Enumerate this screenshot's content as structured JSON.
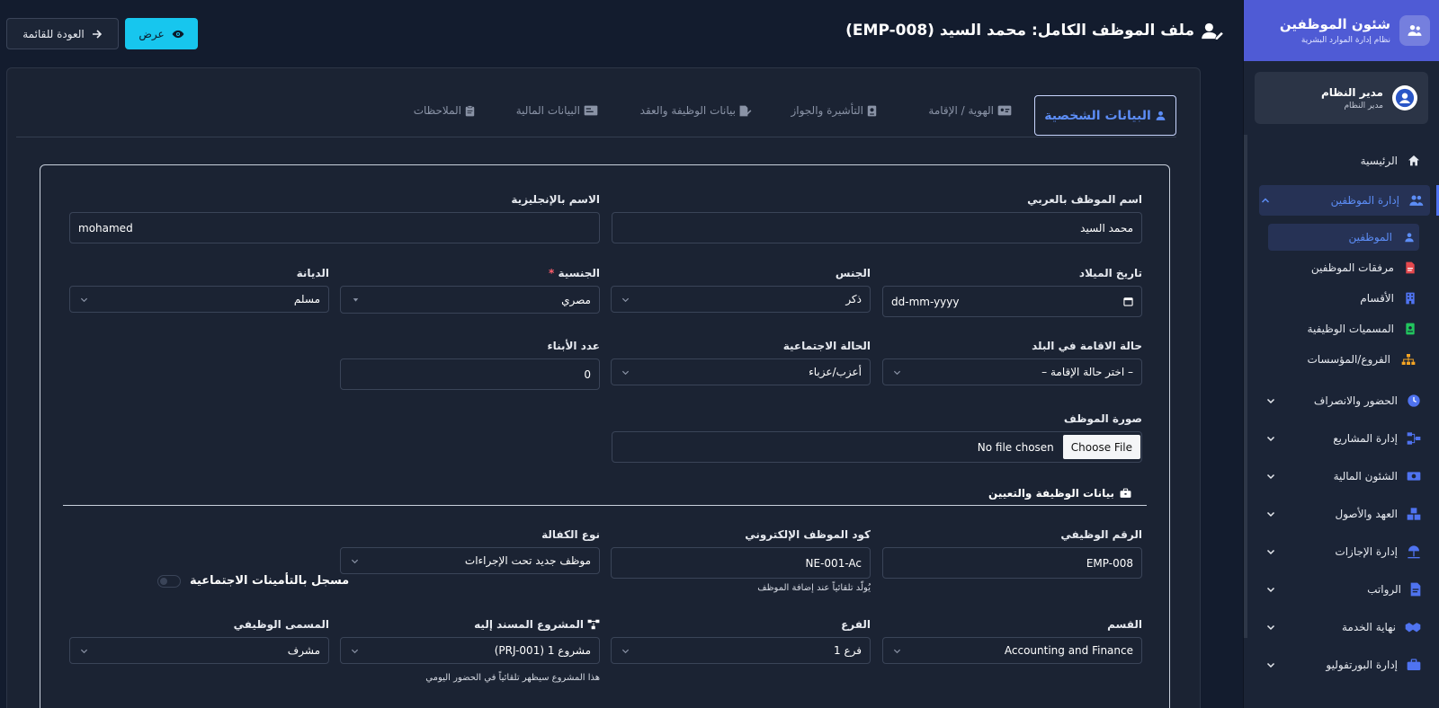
{
  "app": {
    "name": "شئون الموظفين",
    "subtitle": "نظام إدارة الموارد البشرية"
  },
  "user": {
    "name": "مدير النظام",
    "role": "مدير النظام"
  },
  "nav": {
    "home": "الرئيسية",
    "employees_mgmt": "إدارة الموظفين",
    "sub": {
      "employees": "الموظفين",
      "attachments": "مرفقات الموظفين",
      "departments": "الأقسام",
      "job_titles": "المسميات الوظيفية",
      "branches": "الفروع/المؤسسات"
    },
    "attendance": "الحضور والانصراف",
    "projects": "إدارة المشاريع",
    "finance": "الشئون المالية",
    "assets": "العهد والأصول",
    "leaves": "إدارة الإجازات",
    "salaries": "الرواتب",
    "end_of_service": "نهاية الخدمة",
    "portfolio": "إدارة البورتفوليو"
  },
  "header": {
    "title": "ملف الموظف الكامل: محمد السيد (EMP-008)",
    "view_btn": "عرض",
    "back_btn": "العودة للقائمة"
  },
  "tabs": {
    "personal": "البيانات الشخصية",
    "identity": "الهوية / الإقامة",
    "visa": "التأشيرة والجواز",
    "job": "بيانات الوظيفة والعقد",
    "financial": "البيانات المالية",
    "notes": "الملاحظات"
  },
  "form": {
    "name_ar": {
      "label": "اسم الموظف بالعربي",
      "value": "محمد السيد"
    },
    "name_en": {
      "label": "الاسم بالإنجليزية",
      "value": "mohamed"
    },
    "birth_date": {
      "label": "تاريخ الميلاد",
      "value": "dd-mm-yyyy"
    },
    "gender": {
      "label": "الجنس",
      "value": "ذكر"
    },
    "nationality": {
      "label": "الجنسية",
      "required": "*",
      "value": "مصري"
    },
    "religion": {
      "label": "الديانة",
      "value": "مسلم"
    },
    "residency": {
      "label": "حالة الاقامة في البلد",
      "value": "– اختر حالة الإقامة –"
    },
    "marital": {
      "label": "الحالة الاجتماعية",
      "value": "أعزب/عزباء"
    },
    "children": {
      "label": "عدد الأبناء",
      "value": "0"
    },
    "photo": {
      "label": "صورة الموظف",
      "button": "Choose File",
      "status": "No file chosen"
    }
  },
  "job_section": {
    "title": "بيانات الوظيفة والتعيين",
    "emp_no": {
      "label": "الرقم الوظيفي",
      "value": "EMP-008"
    },
    "e_code": {
      "label": "كود الموظف الإلكتروني",
      "value": "NE-001-Ac",
      "help": "يُولّد تلقائياً عند إضافة الموظف"
    },
    "sponsorship": {
      "label": "نوع الكفالة",
      "value": "موظف جديد تحت الإجراءات"
    },
    "social_insurance": "مسجل بالتأمينات الاجتماعية",
    "department": {
      "label": "القسم",
      "value": "Accounting and Finance"
    },
    "branch": {
      "label": "الفرع",
      "value": "فرع 1"
    },
    "project": {
      "label": "المشروع المسند إليه",
      "value": "مشروع 1 (PRJ-001)",
      "help": "هذا المشروع سيظهر تلقائياً في الحضور اليومي"
    },
    "job_title": {
      "label": "المسمى الوظيفي",
      "value": "مشرف"
    }
  },
  "colors": {
    "accent": "#4f5bd5",
    "active_blue": "#5c8df6",
    "cyan_button": "#17c6ee",
    "background": "#131c2e"
  }
}
